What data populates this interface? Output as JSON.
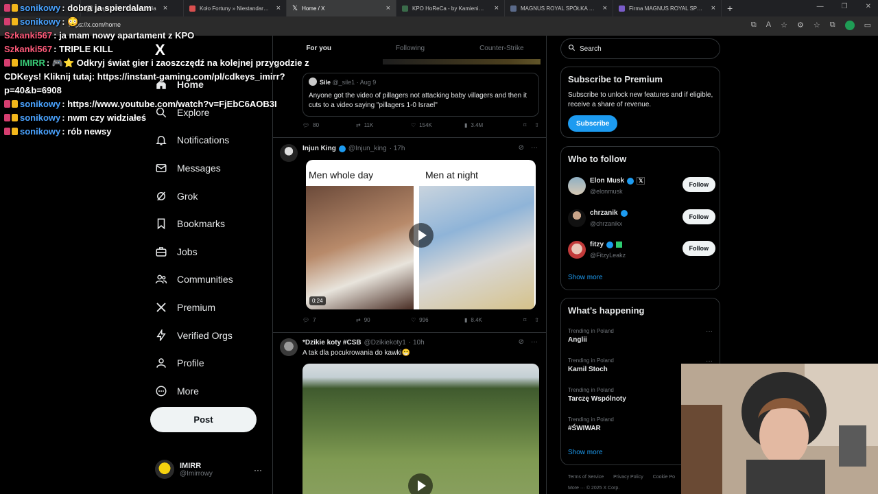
{
  "browser": {
    "tabs": [
      {
        "label": "prądu – Mammonopedia",
        "color": "#7b7b7b",
        "active": false
      },
      {
        "label": "Koło Fortuny » Niestandardowy",
        "color": "#d94f4f",
        "active": false
      },
      {
        "label": "Home / X",
        "color": "#ffffff",
        "active": true
      },
      {
        "label": "KPO HoReCa - by KamieniKupa",
        "color": "#3a6b4a",
        "active": false
      },
      {
        "label": "MAGNUS ROYAL SPÓŁKA Z OGR",
        "color": "#5a6a8a",
        "active": false
      },
      {
        "label": "Firma MAGNUS ROYAL SPÓŁKA",
        "color": "#7a5cc9",
        "active": false
      }
    ],
    "new_tab": "+",
    "url": "https://x.com/home"
  },
  "chat": [
    {
      "user": "sonikowy",
      "color": "#4aa3ff",
      "text": "dobra ja spierdalam",
      "badge": "pink"
    },
    {
      "user": "sonikowy",
      "color": "#4aa3ff",
      "text": "😳",
      "badge": "pink"
    },
    {
      "user": "Szkanki567",
      "color": "#ff5a7a",
      "text": "ja mam nowy apartament z KPO",
      "badge": ""
    },
    {
      "user": "Szkanki567",
      "color": "#ff5a7a",
      "text": "TRIPLE KILL",
      "badge": ""
    },
    {
      "user": "IMIRR",
      "color": "#3ad17a",
      "text": "🎮⭐ Odkryj świat gier i zaoszczędź na kolejnej przygodzie z CDKeys! Kliknij tutaj: https://instant-gaming.com/pl/cdkeys_imirr?p=40&b=6908",
      "badge": "pink"
    },
    {
      "user": "sonikowy",
      "color": "#4aa3ff",
      "text": "https://www.youtube.com/watch?v=FjEbC6AOB3I",
      "badge": "pink"
    },
    {
      "user": "sonikowy",
      "color": "#4aa3ff",
      "text": "nwm czy widziałeś",
      "badge": "pink"
    },
    {
      "user": "sonikowy",
      "color": "#4aa3ff",
      "text": "rób newsy",
      "badge": "pink"
    }
  ],
  "nav": {
    "logo": "X",
    "items": [
      {
        "label": "Home",
        "icon": "home-icon"
      },
      {
        "label": "Explore",
        "icon": "search-icon"
      },
      {
        "label": "Notifications",
        "icon": "bell-icon"
      },
      {
        "label": "Messages",
        "icon": "mail-icon"
      },
      {
        "label": "Grok",
        "icon": "grok-icon"
      },
      {
        "label": "Bookmarks",
        "icon": "bookmark-icon"
      },
      {
        "label": "Jobs",
        "icon": "briefcase-icon"
      },
      {
        "label": "Communities",
        "icon": "people-icon"
      },
      {
        "label": "Premium",
        "icon": "x-icon"
      },
      {
        "label": "Verified Orgs",
        "icon": "lightning-icon"
      },
      {
        "label": "Profile",
        "icon": "person-icon"
      },
      {
        "label": "More",
        "icon": "more-circle-icon"
      }
    ],
    "post": "Post",
    "account": {
      "name": "IMIRR",
      "handle": "@Imirrowy",
      "more": "···"
    }
  },
  "feed": {
    "tabs": [
      "For you",
      "Following",
      "Counter-Strike"
    ],
    "quote": {
      "name": "Sile",
      "handle": "@_sile1",
      "time": "· Aug 9",
      "text": "Anyone got the video of pillagers not attacking baby villagers and then it cuts to a video saying \"pillagers 1-0 Israel\""
    },
    "quote_actions": {
      "replies": "80",
      "reposts": "11K",
      "likes": "154K",
      "views": "3.4M"
    },
    "tweet1": {
      "name": "Injun King",
      "handle": "@Injun_king",
      "time": "· 17h",
      "caption_left": "Men whole day",
      "caption_right": "Men at night",
      "duration": "0:24",
      "actions": {
        "replies": "7",
        "reposts": "90",
        "likes": "996",
        "views": "8.4K"
      }
    },
    "tweet2": {
      "name": "*Dzikie koty #CSB",
      "handle": "@Dzikiekoty1",
      "time": "· 10h",
      "text": "A tak dla pocukrowania do kawki😁"
    }
  },
  "right": {
    "search_placeholder": "Search",
    "premium": {
      "title": "Subscribe to Premium",
      "desc": "Subscribe to unlock new features and if eligible, receive a share of revenue.",
      "button": "Subscribe"
    },
    "who_to_follow": {
      "title": "Who to follow",
      "follow_label": "Follow",
      "users": [
        {
          "name": "Elon Musk",
          "handle": "@elonmusk"
        },
        {
          "name": "chrzanik",
          "handle": "@chrzanikx"
        },
        {
          "name": "fitzy",
          "handle": "@FitzyLeakz"
        }
      ],
      "show_more": "Show more"
    },
    "happening": {
      "title": "What’s happening",
      "trends": [
        {
          "context": "Trending in Poland",
          "topic": "Anglii"
        },
        {
          "context": "Trending in Poland",
          "topic": "Kamil Stoch"
        },
        {
          "context": "Trending in Poland",
          "topic": "Tarczę Wspólnoty"
        },
        {
          "context": "Trending in Poland",
          "topic": "#ŚWIWAR"
        }
      ],
      "show_more": "Show more"
    },
    "footer": [
      "Terms of Service",
      "Privacy Policy",
      "Cookie Po"
    ],
    "footer2": "More ··· © 2025 X Corp."
  }
}
